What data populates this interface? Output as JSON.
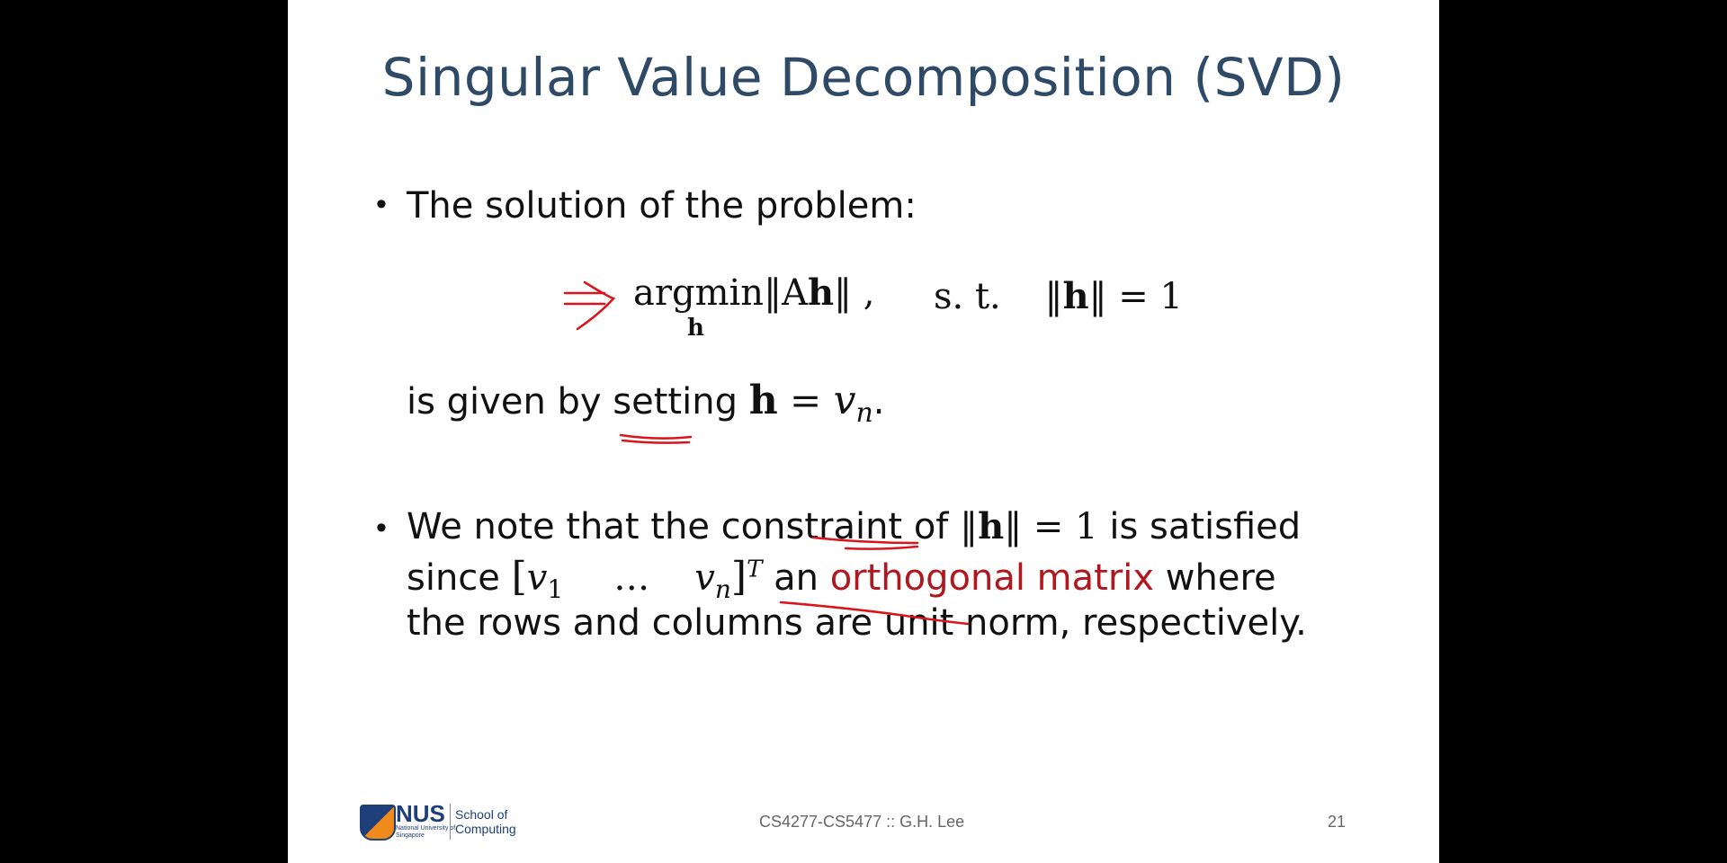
{
  "slide": {
    "title": "Singular Value Decomposition (SVD)",
    "bullet1": {
      "text": "The solution of the problem:"
    },
    "equation": {
      "argmin": "argmin",
      "sub": "h",
      "norm_expr": "‖A",
      "h": "h",
      "norm_close": "‖ ,",
      "st": "s. t.",
      "constraint_open": "‖",
      "constraint_h": "h",
      "constraint_close": "‖ = 1"
    },
    "given": {
      "prefix": "is given by setting ",
      "h": "h",
      "eq": " = ",
      "v": "v",
      "sub": "n",
      "end": "."
    },
    "bullet2": {
      "line1_prefix": "We note that the constraint of ",
      "line1_norm_open": "‖",
      "line1_h": "h",
      "line1_norm_close": "‖ = 1",
      "line1_suffix": " is satisfied",
      "line2_since": "since ",
      "line2_vec_open": "[",
      "line2_v1": "v",
      "line2_sub1": "1",
      "line2_dots": "…",
      "line2_vn": "v",
      "line2_subn": "n",
      "line2_vec_close": "]",
      "line2_sup": "T",
      "line2_an": " an ",
      "line2_red": "orthogonal matrix",
      "line2_where": " where",
      "line3": "the rows and columns are unit norm, respectively."
    },
    "footer": {
      "logo_text": "NUS",
      "logo_sub": "National University of Singapore",
      "school_line1": "School of",
      "school_line2": "Computing",
      "course": "CS4277-CS5477 :: G.H. Lee",
      "page_number": "21"
    },
    "colors": {
      "title": "#2e4a66",
      "accent_red": "#b0171f",
      "background_bars": "#000000"
    }
  }
}
